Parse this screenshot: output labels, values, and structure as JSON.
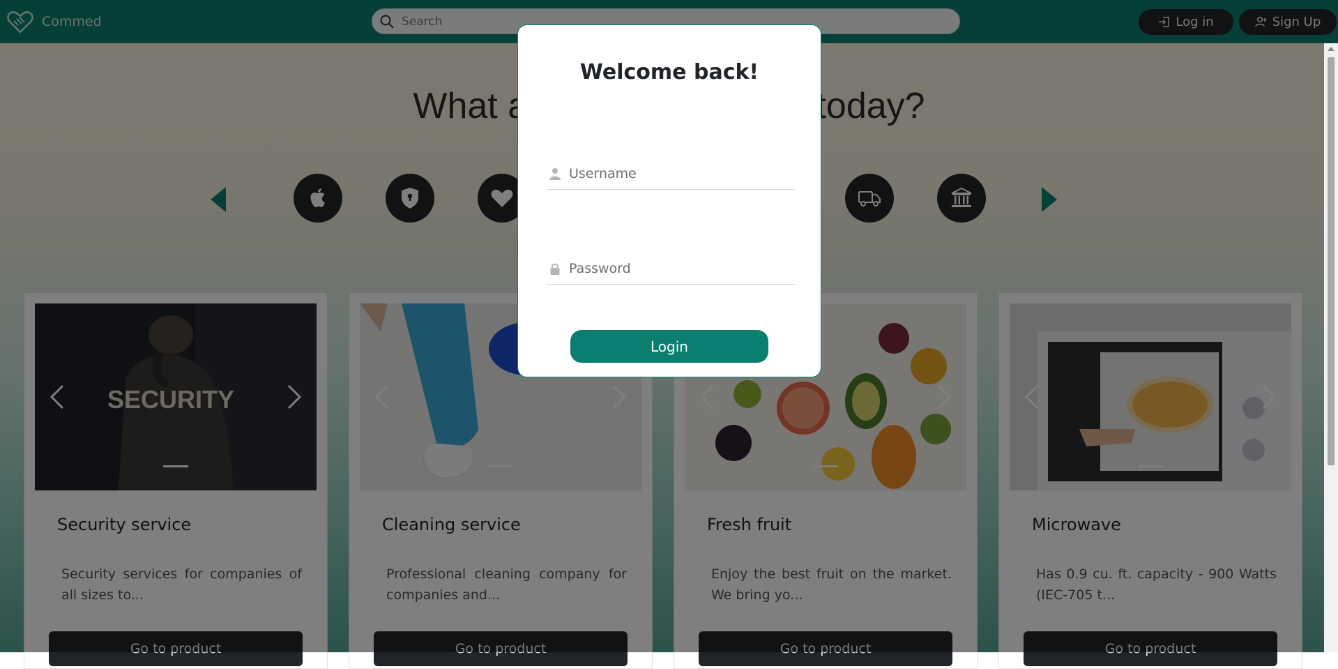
{
  "brand": {
    "name": "Commed"
  },
  "search": {
    "placeholder": "Search"
  },
  "nav": {
    "login_label": "Log in",
    "signup_label": "Sign Up"
  },
  "hero": {
    "headline": "What are you looking for today?"
  },
  "categories": [
    {
      "icon": "apple-icon"
    },
    {
      "icon": "shield-lock-icon"
    },
    {
      "icon": "heart-icon"
    },
    {
      "icon": "truck-icon"
    },
    {
      "icon": "bank-icon"
    }
  ],
  "cards": [
    {
      "title": "Security service",
      "description": "Security services for companies of all sizes to...",
      "button": "Go to product"
    },
    {
      "title": "Cleaning service",
      "description": "Professional cleaning company for companies and...",
      "button": "Go to product"
    },
    {
      "title": "Fresh fruit",
      "description": "Enjoy the best fruit on the market. We bring yo...",
      "button": "Go to product"
    },
    {
      "title": "Microwave",
      "description": "Has 0.9 cu. ft. capacity - 900 Watts (IEC-705 t...",
      "button": "Go to product"
    }
  ],
  "modal": {
    "title": "Welcome back!",
    "username_placeholder": "Username",
    "password_placeholder": "Password",
    "login_label": "Login"
  },
  "colors": {
    "primary": "#0a7f70",
    "dark": "#212529"
  }
}
